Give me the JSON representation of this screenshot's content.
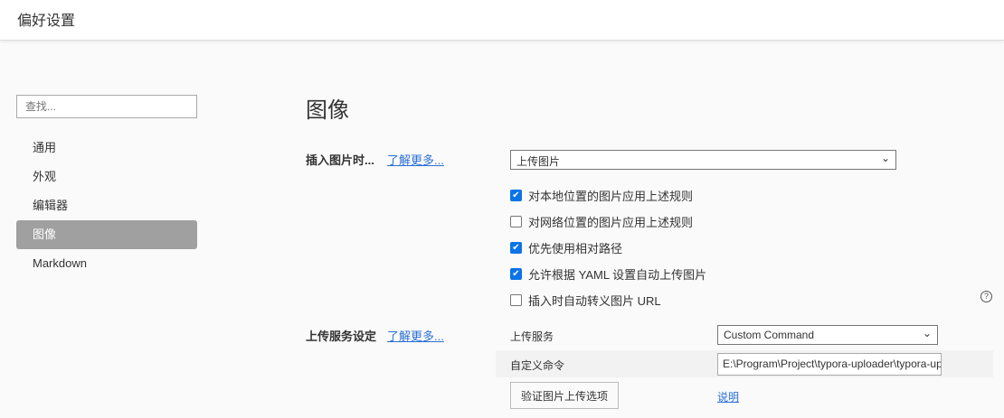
{
  "header": {
    "title": "偏好设置"
  },
  "sidebar": {
    "search_placeholder": "查找...",
    "items": [
      {
        "label": "通用"
      },
      {
        "label": "外观"
      },
      {
        "label": "编辑器"
      },
      {
        "label": "图像"
      },
      {
        "label": "Markdown"
      }
    ],
    "active": "图像"
  },
  "main": {
    "title": "图像",
    "insert": {
      "label": "插入图片时...",
      "learn_more": "了解更多...",
      "select_value": "上传图片",
      "options": [
        {
          "label": "对本地位置的图片应用上述规则",
          "checked": true
        },
        {
          "label": "对网络位置的图片应用上述规则",
          "checked": false
        },
        {
          "label": "优先使用相对路径",
          "checked": true
        },
        {
          "label": "允许根据 YAML 设置自动上传图片",
          "checked": true
        },
        {
          "label": "插入时自动转义图片 URL",
          "checked": false
        }
      ]
    },
    "upload": {
      "label": "上传服务设定",
      "learn_more": "了解更多...",
      "service_label": "上传服务",
      "service_value": "Custom Command",
      "command_label": "自定义命令",
      "command_value": "E:\\Program\\Project\\typora-uploader\\typora-uploader",
      "verify_button": "验证图片上传选项",
      "docs_link": "说明"
    },
    "help_icon": "?"
  }
}
